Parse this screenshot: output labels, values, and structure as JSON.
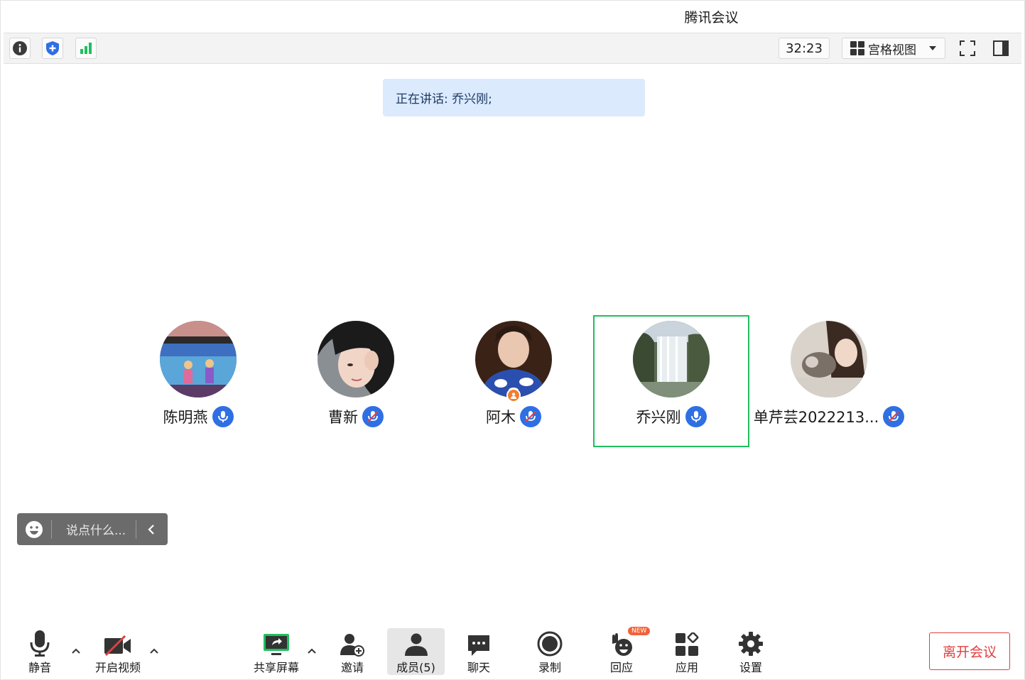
{
  "window": {
    "title": "腾讯会议"
  },
  "toolbar": {
    "info_icon": "info-icon",
    "security_icon": "shield-plus-icon",
    "signal_icon": "signal-bars-icon",
    "timer": "32:23",
    "view_mode": "宫格视图"
  },
  "speaking": {
    "text": "正在讲话: 乔兴刚;"
  },
  "participants": [
    {
      "name": "陈明燕",
      "mic": "on"
    },
    {
      "name": "曹新",
      "mic": "muted"
    },
    {
      "name": "阿木",
      "mic": "muted",
      "host": true
    },
    {
      "name": "乔兴刚",
      "mic": "on",
      "active": true
    },
    {
      "name": "单芹芸2022213...",
      "mic": "muted"
    }
  ],
  "chat": {
    "placeholder": "说点什么..."
  },
  "bottombar": {
    "mute": "静音",
    "video": "开启视频",
    "share": "共享屏幕",
    "invite": "邀请",
    "members": "成员(5)",
    "chat": "聊天",
    "record": "录制",
    "react": "回应",
    "react_badge": "NEW",
    "apps": "应用",
    "settings": "设置",
    "leave": "离开会议"
  },
  "colors": {
    "accent": "#2f6fe4",
    "active_border": "#1fbf5e",
    "leave": "#e0403f",
    "banner": "#dbeafd"
  }
}
